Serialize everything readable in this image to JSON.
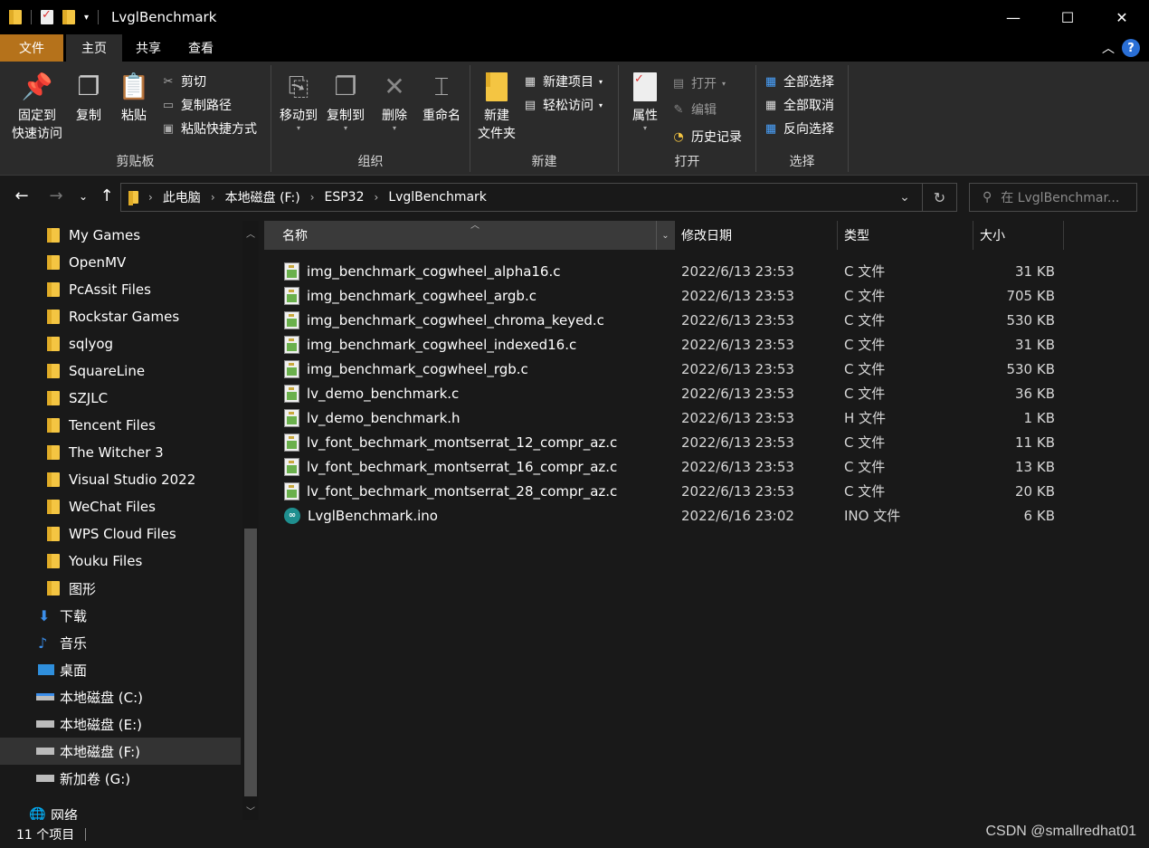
{
  "window": {
    "title": "LvglBenchmark",
    "controls": [
      "—",
      "☐",
      "✕"
    ]
  },
  "ribbon_tabs": {
    "file": "文件",
    "home": "主页",
    "share": "共享",
    "view": "查看"
  },
  "ribbon": {
    "clipboard": {
      "label": "剪贴板",
      "pin": "固定到\n快速访问",
      "pin_line1": "固定到",
      "pin_line2": "快速访问",
      "copy": "复制",
      "paste": "粘贴",
      "cut": "剪切",
      "copy_path": "复制路径",
      "paste_shortcut": "粘贴快捷方式"
    },
    "organize": {
      "label": "组织",
      "move_to": "移动到",
      "copy_to": "复制到",
      "delete": "删除",
      "rename": "重命名"
    },
    "new": {
      "label": "新建",
      "new_folder_line1": "新建",
      "new_folder_line2": "文件夹",
      "new_item": "新建项目",
      "easy_access": "轻松访问"
    },
    "open": {
      "label": "打开",
      "properties": "属性",
      "open": "打开",
      "edit": "编辑",
      "history": "历史记录"
    },
    "select": {
      "label": "选择",
      "select_all": "全部选择",
      "select_none": "全部取消",
      "invert": "反向选择"
    }
  },
  "address": {
    "crumbs": [
      "此电脑",
      "本地磁盘 (F:)",
      "ESP32",
      "LvglBenchmark"
    ],
    "search_placeholder": "在 LvglBenchmar..."
  },
  "nav_pane": {
    "items": [
      {
        "label": "My Games",
        "icon": "folder-icon"
      },
      {
        "label": "OpenMV",
        "icon": "folder-icon"
      },
      {
        "label": "PcAssit Files",
        "icon": "folder-icon"
      },
      {
        "label": "Rockstar Games",
        "icon": "folder-icon"
      },
      {
        "label": "sqlyog",
        "icon": "folder-icon"
      },
      {
        "label": "SquareLine",
        "icon": "folder-icon"
      },
      {
        "label": "SZJLC",
        "icon": "folder-icon"
      },
      {
        "label": "Tencent Files",
        "icon": "folder-icon"
      },
      {
        "label": "The Witcher 3",
        "icon": "folder-icon"
      },
      {
        "label": "Visual Studio 2022",
        "icon": "folder-icon"
      },
      {
        "label": "WeChat Files",
        "icon": "folder-icon"
      },
      {
        "label": "WPS Cloud Files",
        "icon": "folder-icon"
      },
      {
        "label": "Youku Files",
        "icon": "folder-icon"
      },
      {
        "label": "图形",
        "icon": "folder-icon"
      },
      {
        "label": "下载",
        "icon": "download-icon"
      },
      {
        "label": "音乐",
        "icon": "music-icon"
      },
      {
        "label": "桌面",
        "icon": "desktop-icon"
      },
      {
        "label": "本地磁盘 (C:)",
        "icon": "drive-icon"
      },
      {
        "label": "本地磁盘 (E:)",
        "icon": "drive-icon"
      },
      {
        "label": "本地磁盘 (F:)",
        "icon": "drive-icon"
      },
      {
        "label": "新加卷 (G:)",
        "icon": "drive-icon"
      },
      {
        "label": "网络",
        "icon": "network-icon"
      }
    ]
  },
  "file_list": {
    "columns": [
      "名称",
      "修改日期",
      "类型",
      "大小"
    ],
    "rows": [
      {
        "name": "img_benchmark_cogwheel_alpha16.c",
        "date": "2022/6/13 23:53",
        "type": "C 文件",
        "size": "31 KB",
        "icon": "c-file-icon"
      },
      {
        "name": "img_benchmark_cogwheel_argb.c",
        "date": "2022/6/13 23:53",
        "type": "C 文件",
        "size": "705 KB",
        "icon": "c-file-icon"
      },
      {
        "name": "img_benchmark_cogwheel_chroma_keyed.c",
        "date": "2022/6/13 23:53",
        "type": "C 文件",
        "size": "530 KB",
        "icon": "c-file-icon"
      },
      {
        "name": "img_benchmark_cogwheel_indexed16.c",
        "date": "2022/6/13 23:53",
        "type": "C 文件",
        "size": "31 KB",
        "icon": "c-file-icon"
      },
      {
        "name": "img_benchmark_cogwheel_rgb.c",
        "date": "2022/6/13 23:53",
        "type": "C 文件",
        "size": "530 KB",
        "icon": "c-file-icon"
      },
      {
        "name": "lv_demo_benchmark.c",
        "date": "2022/6/13 23:53",
        "type": "C 文件",
        "size": "36 KB",
        "icon": "c-file-icon"
      },
      {
        "name": "lv_demo_benchmark.h",
        "date": "2022/6/13 23:53",
        "type": "H 文件",
        "size": "1 KB",
        "icon": "h-file-icon"
      },
      {
        "name": "lv_font_bechmark_montserrat_12_compr_az.c",
        "date": "2022/6/13 23:53",
        "type": "C 文件",
        "size": "11 KB",
        "icon": "c-file-icon"
      },
      {
        "name": "lv_font_bechmark_montserrat_16_compr_az.c",
        "date": "2022/6/13 23:53",
        "type": "C 文件",
        "size": "13 KB",
        "icon": "c-file-icon"
      },
      {
        "name": "lv_font_bechmark_montserrat_28_compr_az.c",
        "date": "2022/6/13 23:53",
        "type": "C 文件",
        "size": "20 KB",
        "icon": "c-file-icon"
      },
      {
        "name": "LvglBenchmark.ino",
        "date": "2022/6/16 23:02",
        "type": "INO 文件",
        "size": "6 KB",
        "icon": "arduino-icon"
      }
    ]
  },
  "status": {
    "count": "11 个项目",
    "watermark": "CSDN @smallredhat01"
  },
  "colors": {
    "file_tab": "#b5721b",
    "ribbon_bg": "#2b2b2b",
    "window_bg": "#191919",
    "accent": "#2a6fd6"
  }
}
